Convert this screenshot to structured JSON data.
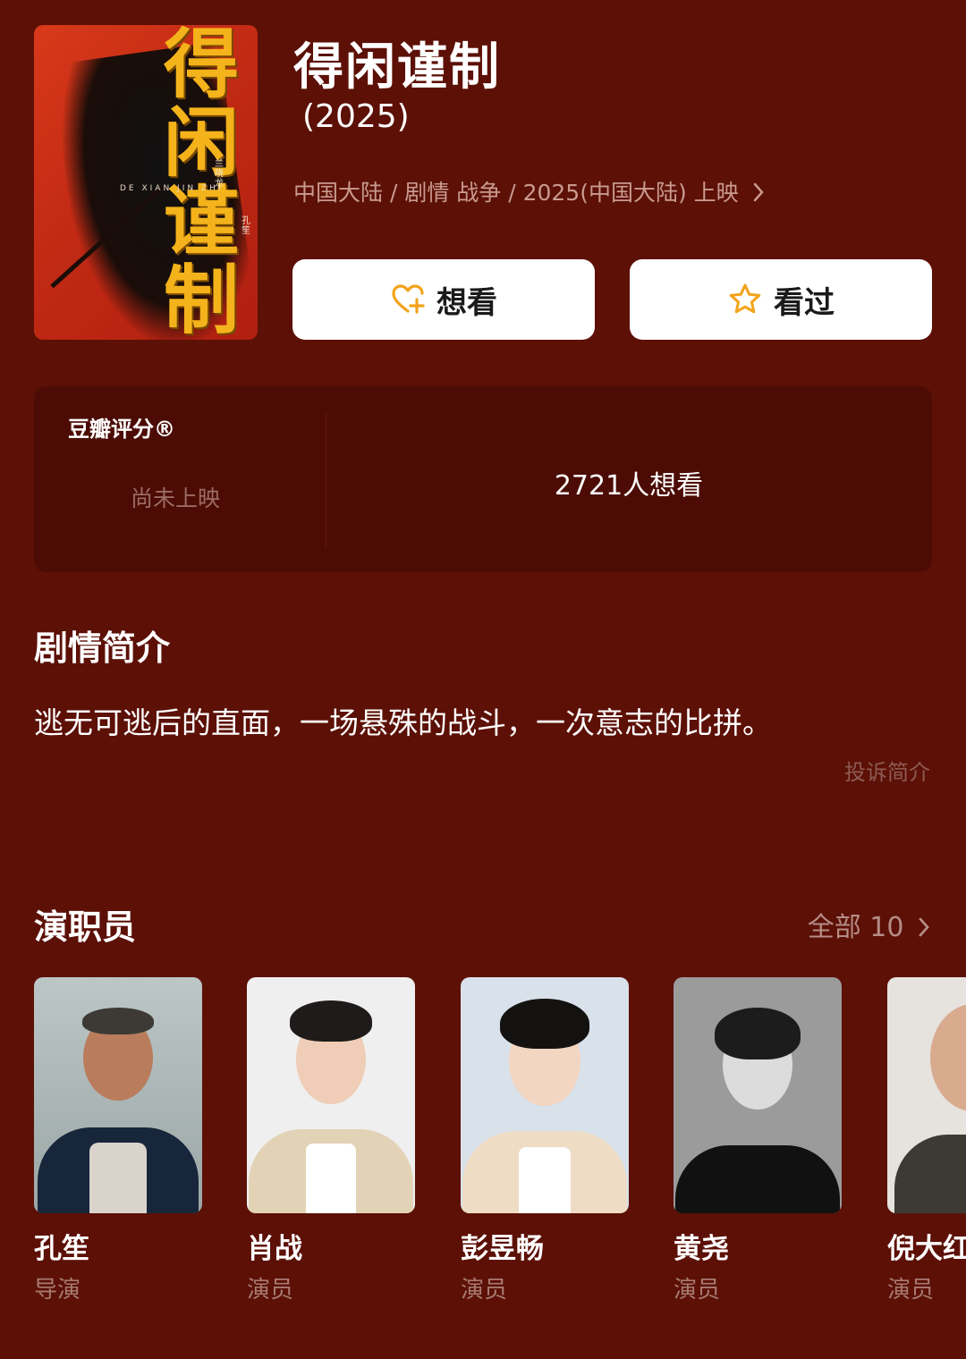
{
  "movie": {
    "title": "得闲谨制",
    "year": "(2025)",
    "meta": "中国大陆 / 剧情 战争 / 2025(中国大陆) 上映",
    "poster": {
      "calligraphy": "得闲谨制",
      "latin": "DE XIAN JIN ZHI",
      "credit_left": "兰晓龙",
      "credit_right": "孔笙"
    }
  },
  "actions": {
    "want_label": "想看",
    "seen_label": "看过"
  },
  "rating": {
    "label": "豆瓣评分®",
    "status": "尚未上映",
    "wants": "2721人想看"
  },
  "synopsis": {
    "heading": "剧情简介",
    "text": "逃无可逃后的直面，一场悬殊的战斗，一次意志的比拼。",
    "report": "投诉简介"
  },
  "cast": {
    "heading": "演职员",
    "all_label": "全部 10",
    "members": [
      {
        "name": "孔笙",
        "role": "导演"
      },
      {
        "name": "肖战",
        "role": "演员"
      },
      {
        "name": "彭昱畅",
        "role": "演员"
      },
      {
        "name": "黄尧",
        "role": "演员"
      },
      {
        "name": "倪大红",
        "role": "演员"
      }
    ]
  },
  "icons": {
    "chevron": "chevron-right-icon",
    "want": "heart-plus-icon",
    "seen": "star-icon"
  },
  "colors": {
    "background": "#5c1006",
    "accent": "#f3a31b"
  }
}
